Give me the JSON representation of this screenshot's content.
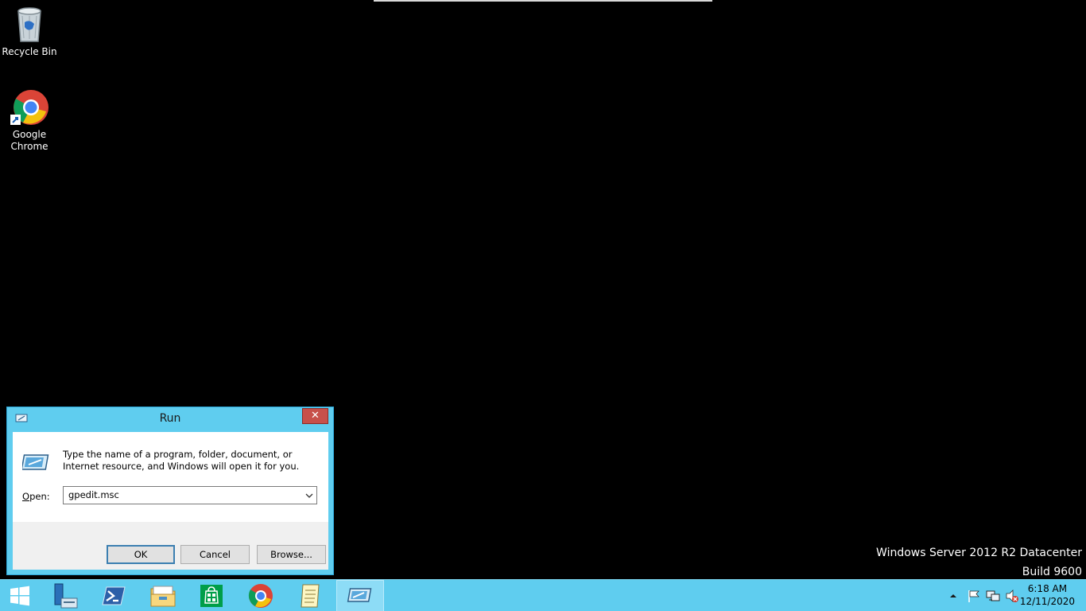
{
  "desktop": {
    "icons": [
      {
        "label": "Recycle Bin",
        "icon": "recycle-bin-icon"
      },
      {
        "label": "Google Chrome",
        "icon": "chrome-icon"
      }
    ],
    "watermark": {
      "line1": "Windows Server 2012 R2 Datacenter",
      "line2": "Build 9600"
    }
  },
  "run_dialog": {
    "title": "Run",
    "close_label": "✕",
    "description": "Type the name of a program, folder, document, or Internet resource, and Windows will open it for you.",
    "open_label_prefix": "",
    "open_label_accel": "O",
    "open_label_rest": "pen:",
    "open_value": "gpedit.msc",
    "ok_label": "OK",
    "cancel_label": "Cancel",
    "browse_label": "Browse..."
  },
  "taskbar": {
    "items": [
      {
        "name": "start-button",
        "icon": "windows-logo-icon"
      },
      {
        "name": "server-manager",
        "icon": "server-manager-icon"
      },
      {
        "name": "powershell",
        "icon": "powershell-icon"
      },
      {
        "name": "file-explorer",
        "icon": "folder-icon"
      },
      {
        "name": "store",
        "icon": "store-icon"
      },
      {
        "name": "chrome",
        "icon": "chrome-icon"
      },
      {
        "name": "notepad",
        "icon": "notepad-icon"
      },
      {
        "name": "run",
        "icon": "run-icon",
        "active": true
      }
    ],
    "tray": {
      "time": "6:18 AM",
      "date": "12/11/2020"
    }
  },
  "colors": {
    "taskbar": "#5fcdef",
    "close": "#c7504a",
    "desktop": "#000000"
  }
}
